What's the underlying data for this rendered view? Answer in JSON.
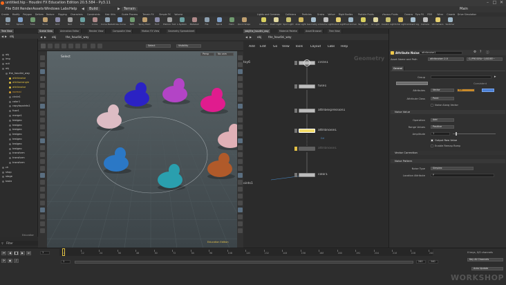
{
  "window": {
    "title": "untitled.hip - Houdini FX Education Edition 20.5.584 - Py3.11",
    "minimize_icon": "minimize-icon",
    "maximize_icon": "maximize-icon",
    "close_icon": "close-icon"
  },
  "menubar": {
    "items": [
      "File",
      "Edit",
      "Render",
      "Assets",
      "Windows",
      "Labs",
      "Help"
    ],
    "desktop_build": "Build",
    "desktop_terrain": "Terrain",
    "main_label": "Main"
  },
  "shelf_left": {
    "tabs": [
      "Create",
      "Modify",
      "Polygon",
      "Deform",
      "Texture",
      "Rigging",
      "Characters",
      "Constraints",
      "Hair Utils",
      "Guide Process",
      "Terrain FX",
      "Simple FX",
      "Volume"
    ],
    "tools": [
      "Box",
      "Sphere",
      "Tube",
      "Torus",
      "Grid",
      "Null",
      "Line",
      "Circle",
      "Curve Bezier",
      "Draw Curve",
      "Path",
      "Spray Paint",
      "Font",
      "Platonic Solids",
      "L-System",
      "Metaball",
      "File",
      "Spiral",
      "Helix",
      "Quick Shapes"
    ]
  },
  "shelf_right": {
    "tabs": [
      "Lights and Cameras",
      "Collisions",
      "Particles",
      "Grains",
      "Vellum",
      "Rigid Bodies",
      "Particle Fluids",
      "Viscous Fluids",
      "Oceans",
      "Pyro FX",
      "FEM",
      "Wires",
      "Crowds",
      "Drive Simulation"
    ],
    "tools": [
      "Camera",
      "Point Light",
      "Spot Light",
      "Area Light",
      "Geometry Light",
      "Volume Light",
      "Distant Light",
      "Environment Light",
      "Sky Light",
      "GI Light",
      "Caustic Light",
      "Portal Light",
      "Ambient Light",
      "Camera",
      "VR Camera",
      "Switcher"
    ]
  },
  "tree_pane": {
    "tabs": [
      "Tree View",
      "Material Palette",
      "Asset Browser"
    ],
    "path": "obj",
    "rows": [
      "obj",
      "img",
      "out",
      "obj",
      "the_houdini_way",
      "attribnoise",
      "attribwrangle",
      "attribnoise",
      "normal",
      "circle1",
      "color1",
      "copytopoints1",
      "fuse1",
      "merge1",
      "testgeo",
      "testgeo",
      "testgeo",
      "testgeo",
      "testgeo",
      "testgeo",
      "testgeo",
      "transform",
      "transform",
      "transform",
      "ch",
      "shop",
      "stage",
      "tasks"
    ],
    "context": "Education",
    "filter_label": "Filter"
  },
  "viewport": {
    "tabs": [
      "Scene View",
      "Animation Editor",
      "Render View",
      "Composite View",
      "Motion FX View",
      "Geometry Spreadsheet"
    ],
    "path_obj": "obj",
    "path_node": "the_houdini_way",
    "select_label": "Select",
    "select_dropdown": "Select",
    "visibility_dropdown": "Visibility",
    "camera_label": "Persp",
    "cam_menu": "No cam",
    "watermark": "Education Edition"
  },
  "network": {
    "tabs": [
      "/obj/the_houdini_way",
      "Material Palette",
      "Asset Browser",
      "Tree View"
    ],
    "path_obj": "obj",
    "path_node": "the_houdini_way",
    "menu": [
      "Add",
      "Edit",
      "Go",
      "View",
      "Tools",
      "Layout",
      "Labs",
      "Help"
    ],
    "context_label": "Geometry",
    "nodes": [
      "circle1",
      "fuse1",
      "attribexpression1",
      "attribnoise1",
      "attribnoise1",
      "color1"
    ],
    "left_labels": [
      "toy6",
      "oints1"
    ],
    "selected_flag": "Cd"
  },
  "params": {
    "node_type": "Attribute Noise",
    "node_name": "attribnoise1",
    "asset_name_label": "Asset Name and Path",
    "asset_name_value": "attribnoise::2.0",
    "asset_path_value": "C:/PROGRA~1/SIDEE~",
    "tabs": [
      "General"
    ],
    "group_label": "Group",
    "attributes_label": "Attributes",
    "attr_type": "Vector",
    "attr_value": "Cd",
    "attr_class_label": "Attribute Class",
    "attr_class_value": "Point",
    "noise_along_vector": "Noise Along Vector",
    "section_noise_value": "Noise Value",
    "operation_label": "Operation",
    "operation_value": "Add",
    "range_label": "Range Values",
    "range_value": "Positive",
    "amplitude_label": "Amplitude",
    "amplitude_value": "1",
    "output_raw": "Output Raw Value",
    "enable_remap": "Enable Remap Ramp",
    "section_noise_pattern": "Noise Pattern",
    "section_vector_correction": "Vector Correction",
    "noise_type_label": "Noise Type",
    "noise_type_value": "Simplex",
    "loc_attr_label": "Location Attribute",
    "loc_attr_value": "P",
    "consistent": "Consistent"
  },
  "timeline": {
    "ticks": [
      "1",
      "12",
      "24",
      "36",
      "48",
      "60",
      "72",
      "84",
      "96",
      "108",
      "120",
      "132",
      "144",
      "156",
      "168",
      "180",
      "192",
      "204",
      "216",
      "228",
      "240"
    ],
    "current_frame": "1",
    "start_frame": "1",
    "end_frame": "240",
    "end_frame2": "240",
    "keys_info": "0 keys, 0/0 channels",
    "key_all": "Key All Channels",
    "auto_update": "Auto Update",
    "brand": "WORKSHOP"
  },
  "colors": {
    "viewport_top": "#5a6468",
    "viewport_bottom": "#3c4448",
    "grid": "#4f5a5e",
    "node_selected": "#f3dc6a",
    "accent_yellow": "#e3c046",
    "creatures": [
      "#ddbcc4",
      "#2b22c4",
      "#b344c6",
      "#e01c8e",
      "#2b78c6",
      "#2a9fae",
      "#b05a2a",
      "#e0b0b6"
    ]
  }
}
